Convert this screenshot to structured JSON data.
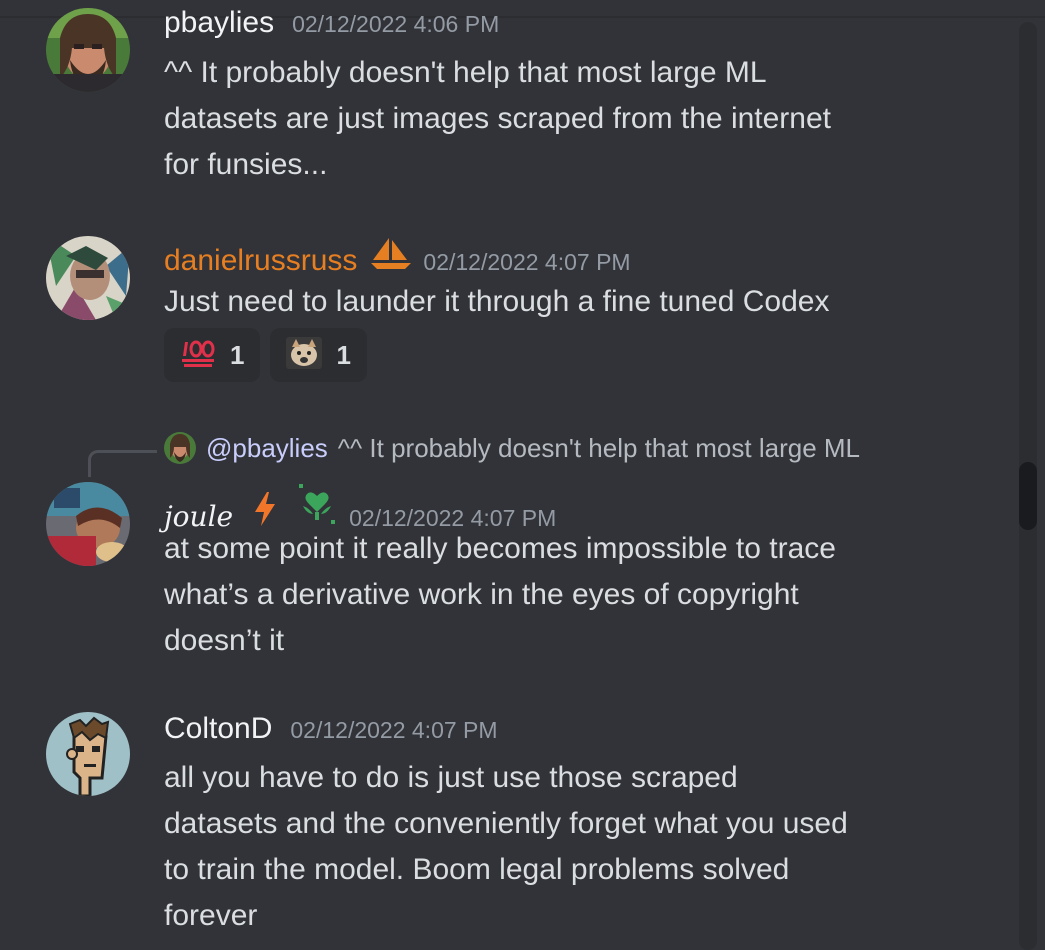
{
  "messages": [
    {
      "username": "pbaylies",
      "timestamp": "02/12/2022 4:06 PM",
      "lines": [
        "^^ It probably doesn't help that most large ML",
        "datasets are just images scraped from the internet",
        "for funsies..."
      ]
    },
    {
      "username": "danielrussruss",
      "badge_icon": "sailboat-icon",
      "name_color": "#e67e22",
      "timestamp": "02/12/2022 4:07 PM",
      "lines": [
        "Just need to launder it through a fine tuned Codex"
      ],
      "reactions": [
        {
          "emoji": "hundred-points-icon",
          "count": "1"
        },
        {
          "emoji": "dog-face-emoji",
          "count": "1"
        }
      ]
    },
    {
      "reply": {
        "mention": "@pbaylies",
        "preview": "^^ It probably doesn't help that most large ML"
      },
      "username": "joule",
      "badges": [
        "lightning-bolt-icon",
        "green-heart-plant-icon"
      ],
      "timestamp": "02/12/2022 4:07 PM",
      "lines": [
        "at some point it really becomes impossible to trace",
        "what’s a derivative work in the eyes of copyright",
        "doesn’t it"
      ]
    },
    {
      "username": "ColtonD",
      "timestamp": "02/12/2022 4:07 PM",
      "lines": [
        "all you have to do is just use those scraped",
        "datasets and the conveniently forget what you used",
        "to train the model. Boom legal problems solved",
        "forever"
      ]
    }
  ],
  "colors": {
    "background": "#313338",
    "text": "#dbdee1",
    "timestamp": "#949ba4",
    "mention": "#c9cdfb",
    "reaction_bg": "#2b2d31"
  }
}
